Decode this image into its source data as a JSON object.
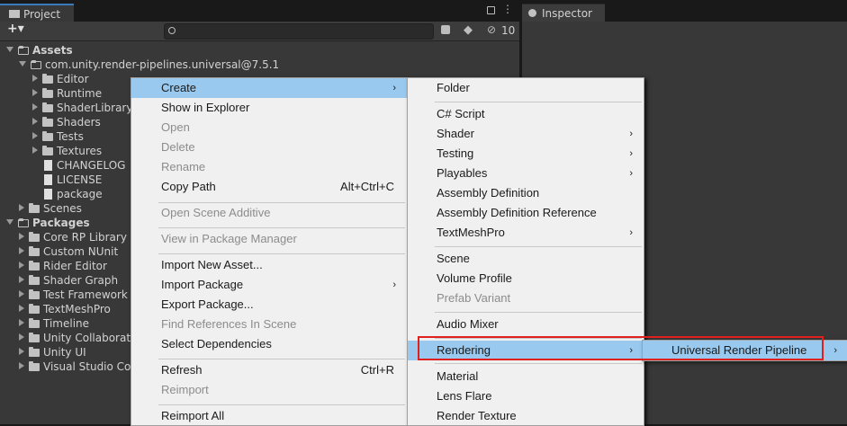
{
  "project_tab": {
    "label": "Project"
  },
  "inspector_tab": {
    "label": "Inspector"
  },
  "toolbar": {
    "add_label": "+▾",
    "hidden_count": "10"
  },
  "tree": {
    "assets": "Assets",
    "package_root": "com.unity.render-pipelines.universal@7.5.1",
    "asset_children": [
      "Editor",
      "Runtime",
      "ShaderLibrary",
      "Shaders",
      "Tests",
      "Textures"
    ],
    "asset_files": [
      "CHANGELOG",
      "LICENSE",
      "package"
    ],
    "scenes": "Scenes",
    "packages": "Packages",
    "package_children": [
      "Core RP Library",
      "Custom NUnit",
      "Rider Editor",
      "Shader Graph",
      "Test Framework",
      "TextMeshPro",
      "Timeline",
      "Unity Collaborate",
      "Unity UI",
      "Visual Studio Code"
    ]
  },
  "context_menu": {
    "create": "Create",
    "show_in_explorer": "Show in Explorer",
    "open": "Open",
    "delete": "Delete",
    "rename": "Rename",
    "copy_path": "Copy Path",
    "copy_path_shortcut": "Alt+Ctrl+C",
    "open_scene_additive": "Open Scene Additive",
    "view_in_package_manager": "View in Package Manager",
    "import_new_asset": "Import New Asset...",
    "import_package": "Import Package",
    "export_package": "Export Package...",
    "find_references": "Find References In Scene",
    "select_dependencies": "Select Dependencies",
    "refresh": "Refresh",
    "refresh_shortcut": "Ctrl+R",
    "reimport": "Reimport",
    "reimport_all": "Reimport All",
    "submenu_arrow": "›"
  },
  "create_menu": {
    "folder": "Folder",
    "csharp_script": "C# Script",
    "shader": "Shader",
    "testing": "Testing",
    "playables": "Playables",
    "assembly_definition": "Assembly Definition",
    "assembly_definition_reference": "Assembly Definition Reference",
    "textmeshpro": "TextMeshPro",
    "scene": "Scene",
    "volume_profile": "Volume Profile",
    "prefab_variant": "Prefab Variant",
    "audio_mixer": "Audio Mixer",
    "rendering": "Rendering",
    "material": "Material",
    "lens_flare": "Lens Flare",
    "render_texture": "Render Texture"
  },
  "rendering_menu": {
    "urp": "Universal Render Pipeline"
  },
  "colors": {
    "highlight": "#99c9ef",
    "callout": "#e0201e"
  }
}
